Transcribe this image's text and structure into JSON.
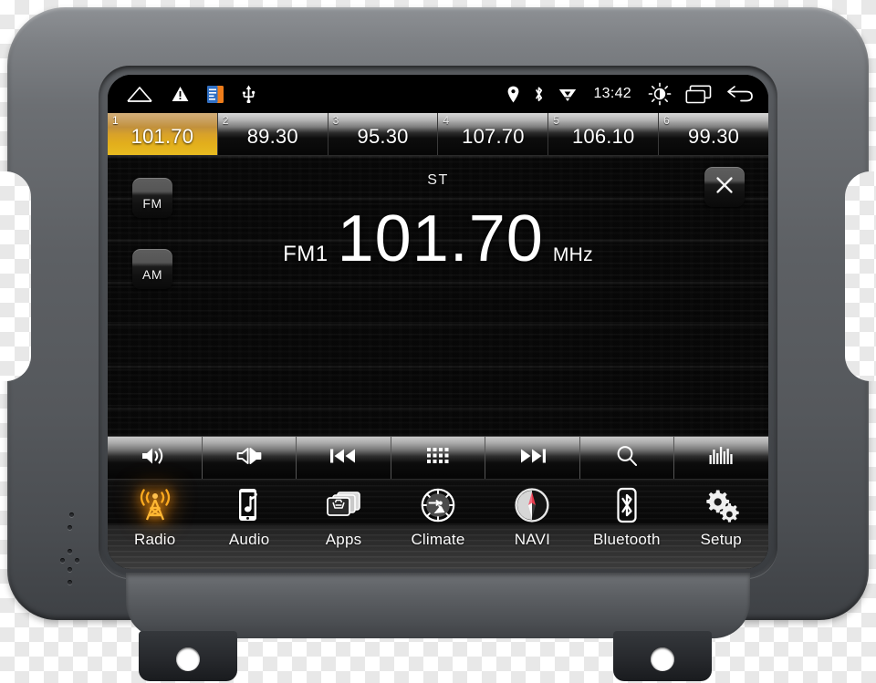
{
  "device": {
    "name": "car-head-unit",
    "accent_color": "#e2ae1c",
    "radio_glow_color": "#ff9b10"
  },
  "statusbar": {
    "clock": "13:42",
    "left_icons": [
      {
        "name": "home-icon",
        "label": "Home"
      },
      {
        "name": "warning-triangle-icon",
        "label": "Warning"
      },
      {
        "name": "sd-card-icon",
        "label": "Storage"
      },
      {
        "name": "usb-icon",
        "label": "USB"
      }
    ],
    "right_icons": [
      {
        "name": "location-pin-icon",
        "label": "GPS"
      },
      {
        "name": "bluetooth-icon",
        "label": "Bluetooth"
      },
      {
        "name": "wifi-icon",
        "label": "Wi-Fi"
      },
      {
        "name": "brightness-icon",
        "label": "Brightness"
      },
      {
        "name": "recent-apps-icon",
        "label": "Recent apps"
      },
      {
        "name": "back-icon",
        "label": "Back"
      }
    ]
  },
  "presets": [
    {
      "num": "1",
      "freq": "101.70",
      "active": true
    },
    {
      "num": "2",
      "freq": "89.30",
      "active": false
    },
    {
      "num": "3",
      "freq": "95.30",
      "active": false
    },
    {
      "num": "4",
      "freq": "107.70",
      "active": false
    },
    {
      "num": "5",
      "freq": "106.10",
      "active": false
    },
    {
      "num": "6",
      "freq": "99.30",
      "active": false
    }
  ],
  "tuner": {
    "fm_button": "FM",
    "am_button": "AM",
    "stereo_indicator": "ST",
    "band": "FM1",
    "frequency": "101.70",
    "unit": "MHz",
    "close_label": "Close"
  },
  "controls": [
    {
      "name": "volume-icon",
      "label": "Volume"
    },
    {
      "name": "balance-icon",
      "label": "Balance / Fader"
    },
    {
      "name": "previous-icon",
      "label": "Previous station"
    },
    {
      "name": "grid-icon",
      "label": "Station list"
    },
    {
      "name": "next-icon",
      "label": "Next station"
    },
    {
      "name": "search-icon",
      "label": "Scan / Search"
    },
    {
      "name": "equalizer-icon",
      "label": "Equalizer"
    }
  ],
  "navbar": [
    {
      "label": "Radio",
      "icon": "radio-tower-icon",
      "active": true
    },
    {
      "label": "Audio",
      "icon": "phone-music-icon",
      "active": false
    },
    {
      "label": "Apps",
      "icon": "app-cards-icon",
      "active": false
    },
    {
      "label": "Climate",
      "icon": "climate-dial-icon",
      "active": false
    },
    {
      "label": "NAVI",
      "icon": "compass-icon",
      "active": false
    },
    {
      "label": "Bluetooth",
      "icon": "bluetooth-icon",
      "active": false
    },
    {
      "label": "Setup",
      "icon": "gears-icon",
      "active": false
    }
  ]
}
